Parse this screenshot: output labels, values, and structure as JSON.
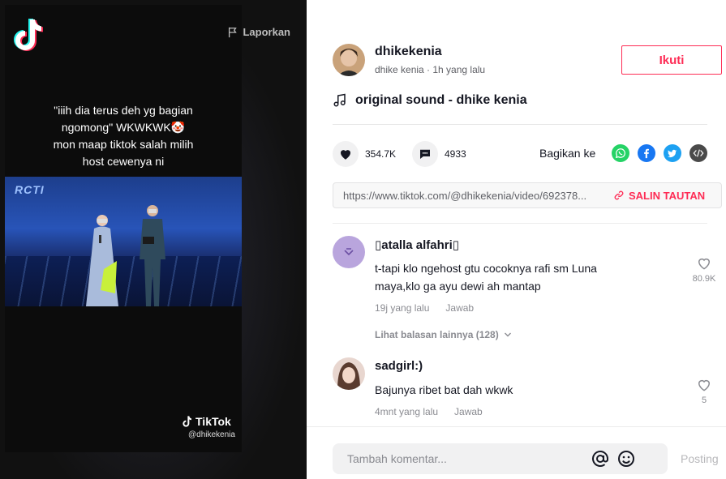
{
  "video": {
    "report_label": "Laporkan",
    "caption_lines": [
      "\"iiih dia terus deh yg bagian",
      "ngomong\" WKWKWK🤡",
      "mon maap tiktok salah milih",
      "host cewenya ni"
    ],
    "channel_logo": "RCTI",
    "watermark_brand": "TikTok",
    "watermark_handle": "@dhikekenia"
  },
  "author": {
    "username": "dhikekenia",
    "subline": "dhike kenia · 1h yang lalu",
    "follow_label": "Ikuti"
  },
  "sound": {
    "icon": "music-note-icon",
    "title": "original sound - dhike kenia"
  },
  "stats": {
    "likes": "354.7K",
    "comments": "4933"
  },
  "share": {
    "label": "Bagikan ke",
    "targets": [
      "whatsapp-icon",
      "facebook-icon",
      "twitter-icon",
      "embed-icon"
    ],
    "colors": {
      "whatsapp": "#25d366",
      "facebook": "#1877f2",
      "twitter": "#1da1f2",
      "embed": "#4a4a4a"
    }
  },
  "link": {
    "url": "https://www.tiktok.com/@dhikekenia/video/692378...",
    "copy_label": "SALIN TAUTAN"
  },
  "comments": [
    {
      "name": "\u0000atalla alfahri\u0000",
      "name_display": "▯atalla alfahri▯",
      "text": "t-tapi klo ngehost gtu cocoknya rafi sm Luna maya,klo ga ayu dewi ah mantap",
      "time": "19j yang lalu",
      "reply_label": "Jawab",
      "likes": "80.9K",
      "more_label": "Lihat balasan lainnya (128)"
    },
    {
      "name_display": "sadgirl:)",
      "text": "Bajunya ribet bat dah wkwk",
      "time": "4mnt yang lalu",
      "reply_label": "Jawab",
      "likes": "5"
    }
  ],
  "composer": {
    "placeholder": "Tambah komentar...",
    "post_label": "Posting"
  },
  "colors": {
    "accent": "#fe2c55",
    "text": "#161823",
    "muted": "#8a8b91"
  }
}
